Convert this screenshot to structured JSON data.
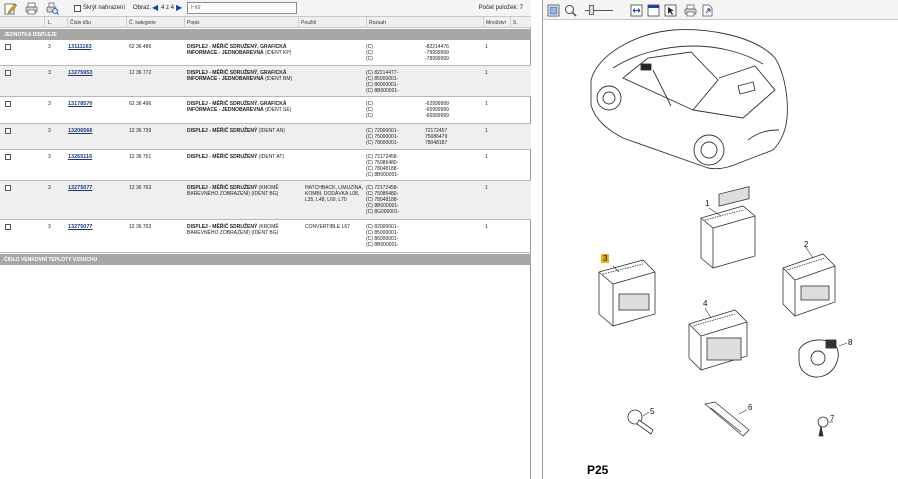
{
  "toolbar": {
    "hide_replaced_label": "Skrýt nahrazení",
    "image_label": "Obraz.",
    "page_indicator": "4 z 4",
    "filter_placeholder": "Filtr",
    "count_label": "Počet položek: 7",
    "icons": [
      "edit-icon",
      "print-icon",
      "print-preview-icon"
    ]
  },
  "columns": [
    "L.",
    "Číslo dílu",
    "Č. kategorie",
    "Popis",
    "Použití",
    "Rozsah",
    "Množství",
    "S."
  ],
  "groups": [
    {
      "label": "JEDNOTKA DISPLEJE"
    },
    {
      "label": "ČIDLO VENKOVNÍ TEPLOTY VZDUCHU"
    }
  ],
  "rows": [
    {
      "level": "3",
      "part_no": "13111163",
      "catalog": "62 36 486",
      "desc_bold": "DISPLEJ - MĚŘIČ SDRUŽENÝ, GRAFICKÁ INFORMACE - JEDNOBAREVNÁ",
      "desc_normal": "(IDENT KP)",
      "usage": "",
      "range": [
        "(C)",
        "(C)",
        "(C)"
      ],
      "range2": [
        "-82214476",
        "-79999999",
        "-78999999"
      ],
      "qty": "1"
    },
    {
      "level": "3",
      "part_no": "13275953",
      "catalog": "12 36 772",
      "desc_bold": "DISPLEJ - MĚŘIČ SDRUŽENÝ, GRAFICKÁ INFORMACE - JEDNOBAREVNÁ",
      "desc_normal": "(IDENT BM)",
      "usage": "",
      "range": [
        "(C) 82214477-",
        "(C) 85000001-",
        "(C) 86000001-",
        "(C) 8B000001-"
      ],
      "range2": [],
      "qty": "1"
    },
    {
      "level": "3",
      "part_no": "13178570",
      "catalog": "62 36 496",
      "desc_bold": "DISPLEJ - MĚŘIČ SDRUŽENÝ, GRAFICKÁ INFORMACE - JEDNOBAREVNÁ",
      "desc_normal": "(IDENT SE)",
      "usage": "",
      "range": [
        "(C)",
        "(C)",
        "(C)"
      ],
      "range2": [
        "-62999999",
        "-65999999",
        "-66999999"
      ],
      "qty": "1"
    },
    {
      "level": "3",
      "part_no": "13206566",
      "catalog": "12 36 739",
      "desc_bold": "DISPLEJ - MĚŘIČ SDRUŽENÝ",
      "desc_normal": "(IDENT AN)",
      "usage": "",
      "range": [
        "(C) 72000001-",
        "(C) 75000001-",
        "(C) 78000001-"
      ],
      "range2": [
        "72172457",
        "75086479",
        "78048187"
      ],
      "qty": "1"
    },
    {
      "level": "3",
      "part_no": "13265116",
      "catalog": "12 36 751",
      "desc_bold": "DISPLEJ - MĚŘIČ SDRUŽENÝ",
      "desc_normal": "(IDENT AT)",
      "usage": "",
      "range": [
        "(C) 72172458-",
        "(C) 75086480-",
        "(C) 78048188-",
        "(C) 8B000001-"
      ],
      "range2": [],
      "qty": "1"
    },
    {
      "level": "3",
      "part_no": "13275077",
      "catalog": "12 36 763",
      "desc_bold": "DISPLEJ - MĚŘIČ SDRUŽENÝ",
      "desc_normal": "(KROMĚ BAREVNÉHO ZOBRAZENÍ) (IDENT BG)",
      "usage": "HATCHBACK, LIMUZÍNA, KOMBI, DODÁVKA L08, L35, L48, L69, L70",
      "range": [
        "(C) 72172458-",
        "(C) 75086480-",
        "(C) 78048188-",
        "(C) 8B000001-",
        "(C) 8G000001-"
      ],
      "range2": [],
      "qty": "1"
    },
    {
      "level": "3",
      "part_no": "13275077",
      "catalog": "12 36 763",
      "desc_bold": "DISPLEJ - MĚŘIČ SDRUŽENÝ",
      "desc_normal": "(KROMĚ BAREVNÉHO ZOBRAZENÍ) (IDENT BG)",
      "usage": "CONVERTIBLE L67",
      "range": [
        "(C) 82000001-",
        "(C) 85000001-",
        "(C) 86000001-",
        "(C) 8B000001-"
      ],
      "range2": [],
      "qty": "1"
    }
  ],
  "viewer": {
    "icons": [
      "fit-page-icon",
      "zoom-icon",
      "zoom-slider",
      "fit-width-icon",
      "window-icon",
      "select-icon",
      "print-icon",
      "export-icon"
    ],
    "plate_label": "P25",
    "callouts": [
      "1",
      "2",
      "3",
      "4",
      "5",
      "6",
      "7",
      "8"
    ],
    "highlighted_callout": "3",
    "highlight_color": "#e6b21c"
  }
}
